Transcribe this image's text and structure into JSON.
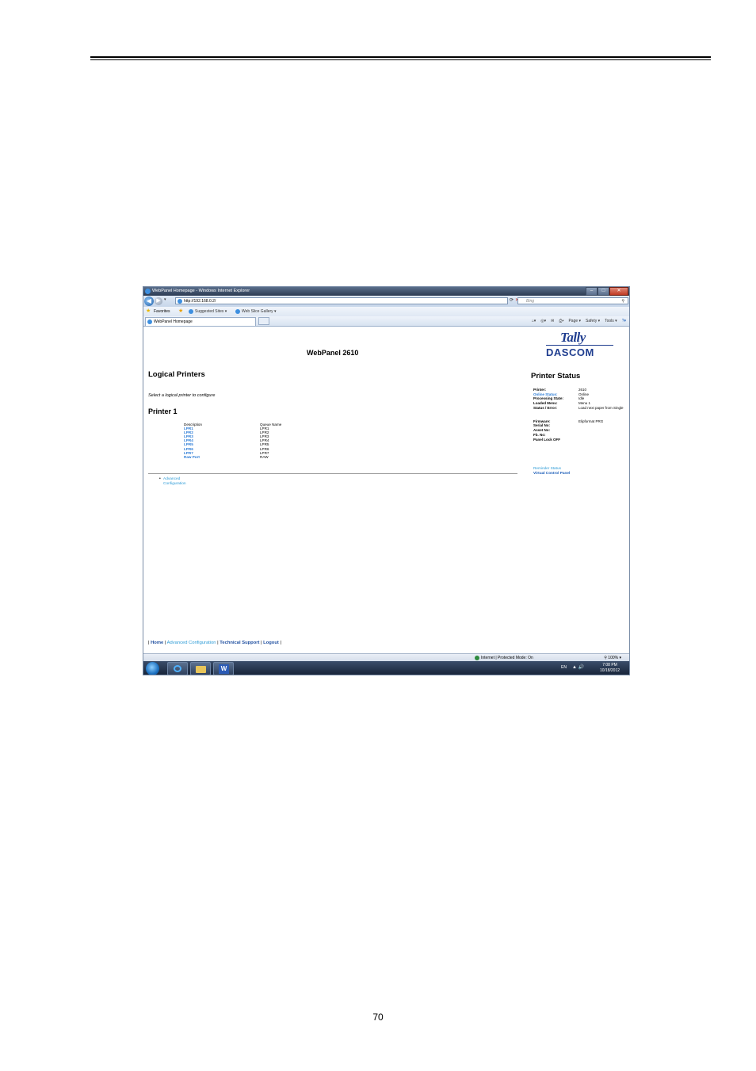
{
  "page": {
    "number": "70"
  },
  "browser": {
    "window_title": "WebPanel Homepage - Windows Internet Explorer",
    "url": "http://192.168.0.2/",
    "search_placeholder": "Bing",
    "favorites_label": "Favorites",
    "suggested_sites": "Suggested Sites ▾",
    "web_slice_gallery": "Web Slice Gallery ▾",
    "tab_label": "WebPanel Homepage",
    "commands": [
      "Page ▾",
      "Safety ▾",
      "Tools ▾"
    ],
    "status_zone": "Internet | Protected Mode: On",
    "zoom": "100%"
  },
  "webpanel": {
    "site_title": "WebPanel 2610",
    "logo_top": "Tally",
    "logo_bottom": "DASCOM",
    "logical_heading": "Logical Printers",
    "select_prompt": "Select a logical printer to configure",
    "printer_heading": "Printer 1",
    "table": {
      "headers": {
        "description": "Description",
        "queue": "Queue Name"
      },
      "rows": [
        {
          "description": "LPR1",
          "queue": "LPR1"
        },
        {
          "description": "LPR2",
          "queue": "LPR2"
        },
        {
          "description": "LPR3",
          "queue": "LPR3"
        },
        {
          "description": "LPR4",
          "queue": "LPR4"
        },
        {
          "description": "LPR5",
          "queue": "LPR5"
        },
        {
          "description": "LPR6",
          "queue": "LPR6"
        },
        {
          "description": "LPR7",
          "queue": "LPR7"
        },
        {
          "description": "Raw Port",
          "queue": "RAW"
        }
      ]
    },
    "advanced_link": "Advanced Configuration",
    "status": {
      "heading": "Printer Status",
      "printer_label": "Printer:",
      "printer_value": "2610",
      "online_label": "Online Status:",
      "online_value": "Online",
      "processing_label": "Processing State:",
      "processing_value": "Idle",
      "menu_label": "Loaded Menu:",
      "menu_value": "Menu 1",
      "error_label": "Status / Error:",
      "error_value": "Load next paper from Single",
      "firmware_label": "Firmware:",
      "firmware_value": "Elipformat PRG",
      "serial_label": "Serial No:",
      "asset_label": "Asset No:",
      "fb_label": "Fb. No:",
      "panel_lock": "Panel Lock OFF",
      "link_status": "Reminder Status",
      "link_vcp": "Virtual Control Panel"
    },
    "footer": {
      "home": "Home",
      "advanced": "Advanced Configuration",
      "support": "Technical Support",
      "logout": "Logout"
    }
  },
  "taskbar": {
    "lang": "EN",
    "time": "7:08 PM",
    "date": "10/18/2012"
  }
}
